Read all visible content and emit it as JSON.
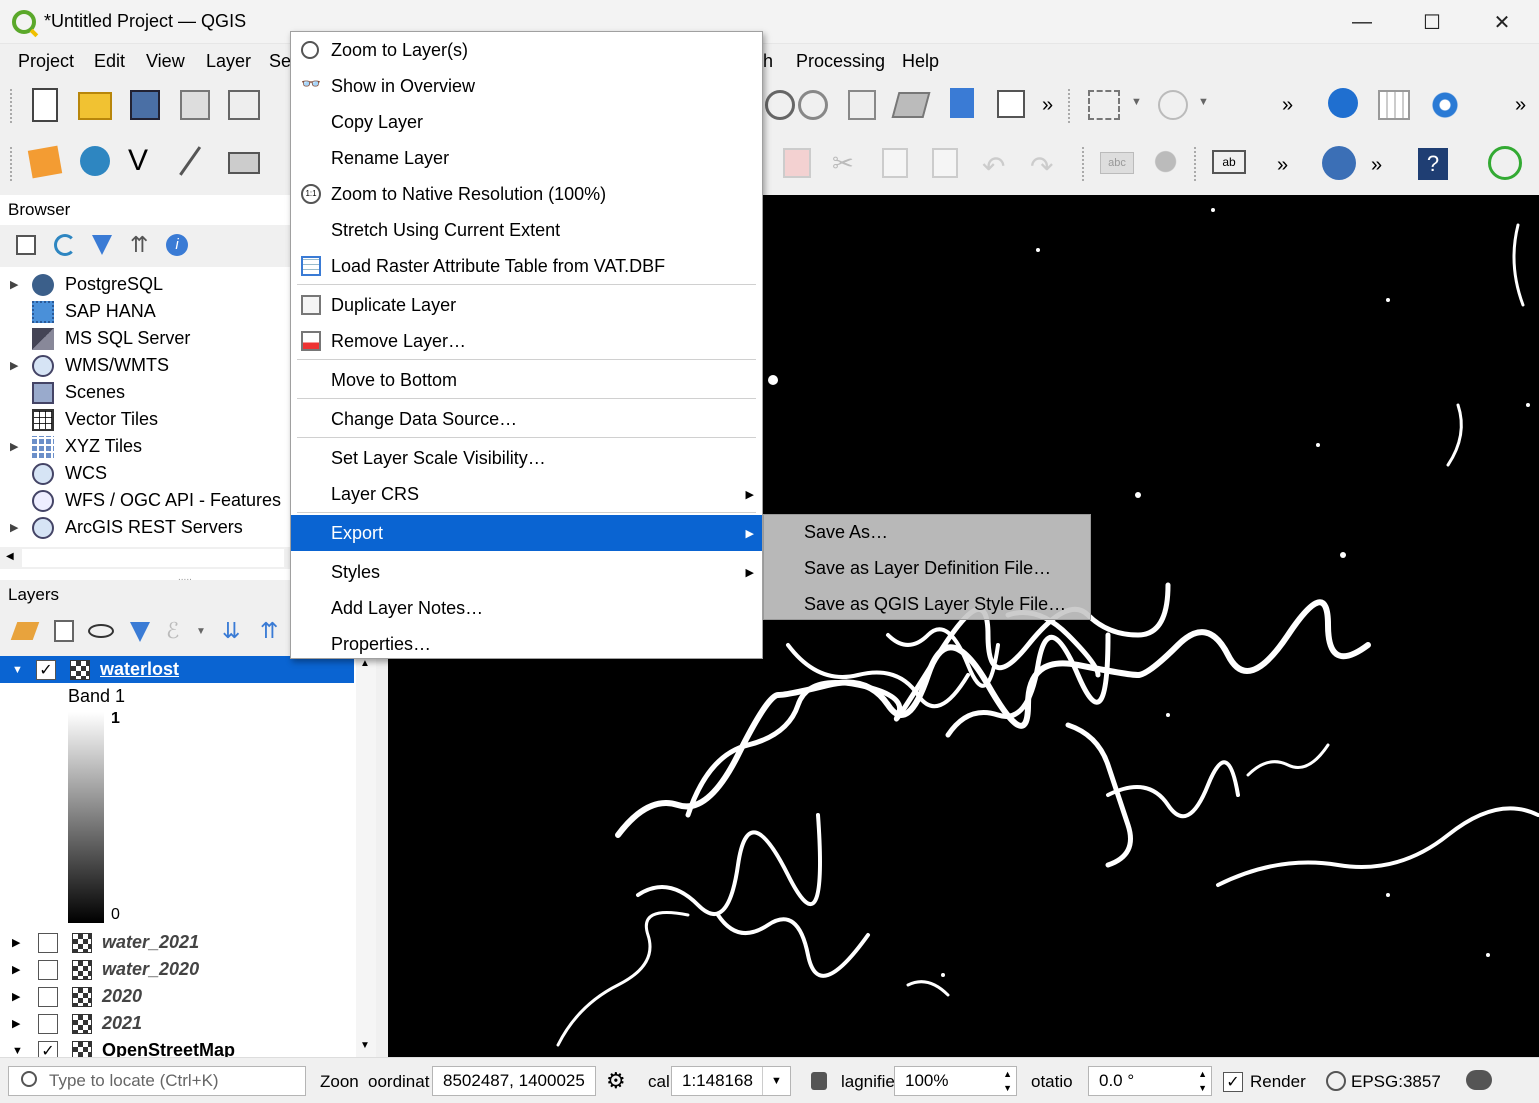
{
  "window": {
    "title": "*Untitled Project — QGIS",
    "minimize": "—",
    "maximize": "☐",
    "close": "✕"
  },
  "menubar": [
    "Project",
    "Edit",
    "View",
    "Layer",
    "Se",
    "h",
    "Processing",
    "Help"
  ],
  "browser": {
    "title": "Browser",
    "items": [
      {
        "label": "PostgreSQL",
        "expandable": true,
        "icon": "postgresql-icon"
      },
      {
        "label": "SAP HANA",
        "expandable": false,
        "icon": "sap-hana-icon"
      },
      {
        "label": "MS SQL Server",
        "expandable": false,
        "icon": "mssql-icon"
      },
      {
        "label": "WMS/WMTS",
        "expandable": true,
        "icon": "wms-icon"
      },
      {
        "label": "Scenes",
        "expandable": false,
        "icon": "scenes-icon"
      },
      {
        "label": "Vector Tiles",
        "expandable": false,
        "icon": "vector-tiles-icon"
      },
      {
        "label": "XYZ Tiles",
        "expandable": true,
        "icon": "xyz-tiles-icon"
      },
      {
        "label": "WCS",
        "expandable": false,
        "icon": "wcs-icon"
      },
      {
        "label": "WFS / OGC API - Features",
        "expandable": false,
        "icon": "wfs-icon"
      },
      {
        "label": "ArcGIS REST Servers",
        "expandable": true,
        "icon": "arcgis-icon"
      }
    ]
  },
  "layers": {
    "title": "Layers",
    "selected": {
      "name": "waterlost",
      "band": "Band 1",
      "max": "1",
      "min": "0"
    },
    "others": [
      {
        "name": "water_2021",
        "checked": false,
        "italic": true
      },
      {
        "name": "water_2020",
        "checked": false,
        "italic": true
      },
      {
        "name": "2020",
        "checked": false,
        "italic": true
      },
      {
        "name": "2021",
        "checked": false,
        "italic": true
      },
      {
        "name": "OpenStreetMap",
        "checked": true,
        "italic": false
      }
    ]
  },
  "context_menu": {
    "items": [
      {
        "label": "Zoom to Layer(s)",
        "icon": "zoom-layer-icon"
      },
      {
        "label": "Show in Overview",
        "icon": "overview-icon"
      },
      {
        "label": "Copy Layer",
        "icon": ""
      },
      {
        "label": "Rename Layer",
        "icon": ""
      },
      {
        "label": "Zoom to Native Resolution (100%)",
        "icon": "native-res-icon"
      },
      {
        "label": "Stretch Using Current Extent",
        "icon": ""
      },
      {
        "label": "Load Raster Attribute Table from VAT.DBF",
        "icon": "table-icon"
      },
      {
        "label": "Duplicate Layer",
        "icon": "duplicate-icon"
      },
      {
        "label": "Remove Layer…",
        "icon": "remove-icon"
      },
      {
        "label": "Move to Bottom",
        "icon": ""
      },
      {
        "label": "Change Data Source…",
        "icon": ""
      },
      {
        "label": "Set Layer Scale Visibility…",
        "icon": ""
      },
      {
        "label": "Layer CRS",
        "icon": ""
      },
      {
        "label": "Export",
        "icon": ""
      },
      {
        "label": "Styles",
        "icon": ""
      },
      {
        "label": "Add Layer Notes…",
        "icon": ""
      },
      {
        "label": "Properties…",
        "icon": ""
      }
    ],
    "submenu": [
      "Save As…",
      "Save as Layer Definition File…",
      "Save as QGIS Layer Style File…"
    ]
  },
  "statusbar": {
    "locate_placeholder": "Type to locate (Ctrl+K)",
    "zoom_label": "Zoon",
    "coord_label": "oordinat",
    "coordinate": "8502487, 1400025",
    "scale_label": "cal",
    "scale": "1:148168",
    "magnifier_label": "lagnifie",
    "magnifier": "100%",
    "rotation_label": "otatio",
    "rotation": "0.0 °",
    "render_label": "Render",
    "crs": "EPSG:3857"
  }
}
